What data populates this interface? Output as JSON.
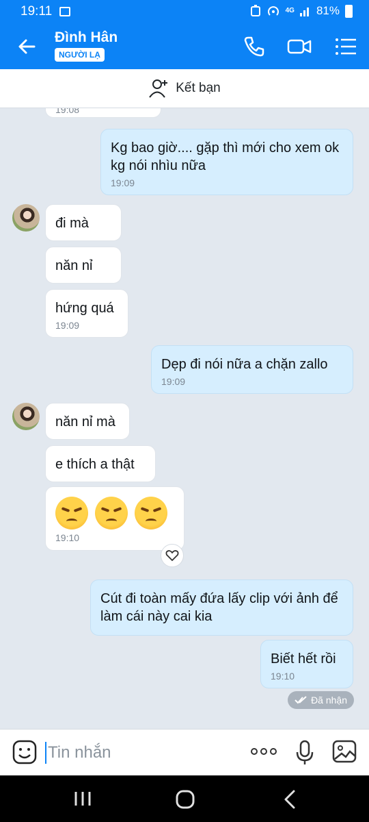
{
  "status": {
    "time": "19:11",
    "network": "4G",
    "battery": "81%"
  },
  "header": {
    "contact_name": "Đình Hân",
    "badge": "NGƯỜI LẠ"
  },
  "friend_bar": {
    "label": "Kết bạn"
  },
  "messages": [
    {
      "text": "19:08"
    },
    {
      "text": "Kg bao giờ.... gặp thì mới cho xem ok kg nói nhìu nữa",
      "time": "19:09"
    },
    {
      "text": "đi mà"
    },
    {
      "text": "năn nỉ"
    },
    {
      "text": "hứng quá",
      "time": "19:09"
    },
    {
      "text": "Dẹp đi nói nữa a chặn zallo",
      "time": "19:09"
    },
    {
      "text": "năn nỉ mà"
    },
    {
      "text": "e thích a thật"
    },
    {
      "emoji": [
        "angry-crying-emoji",
        "angry-crying-emoji",
        "angry-crying-emoji"
      ],
      "time": "19:10"
    },
    {
      "text": "Cút đi toàn mấy đứa lấy clip với ảnh để làm cái này cai kia"
    },
    {
      "text": "Biết hết rồi",
      "time": "19:10"
    }
  ],
  "receipt": {
    "label": "Đã nhận"
  },
  "composer": {
    "placeholder": "Tin nhắn"
  },
  "colors": {
    "accent": "#0c83f6",
    "outgoing_bubble": "#d6eefe",
    "background": "#e2e8ef"
  }
}
